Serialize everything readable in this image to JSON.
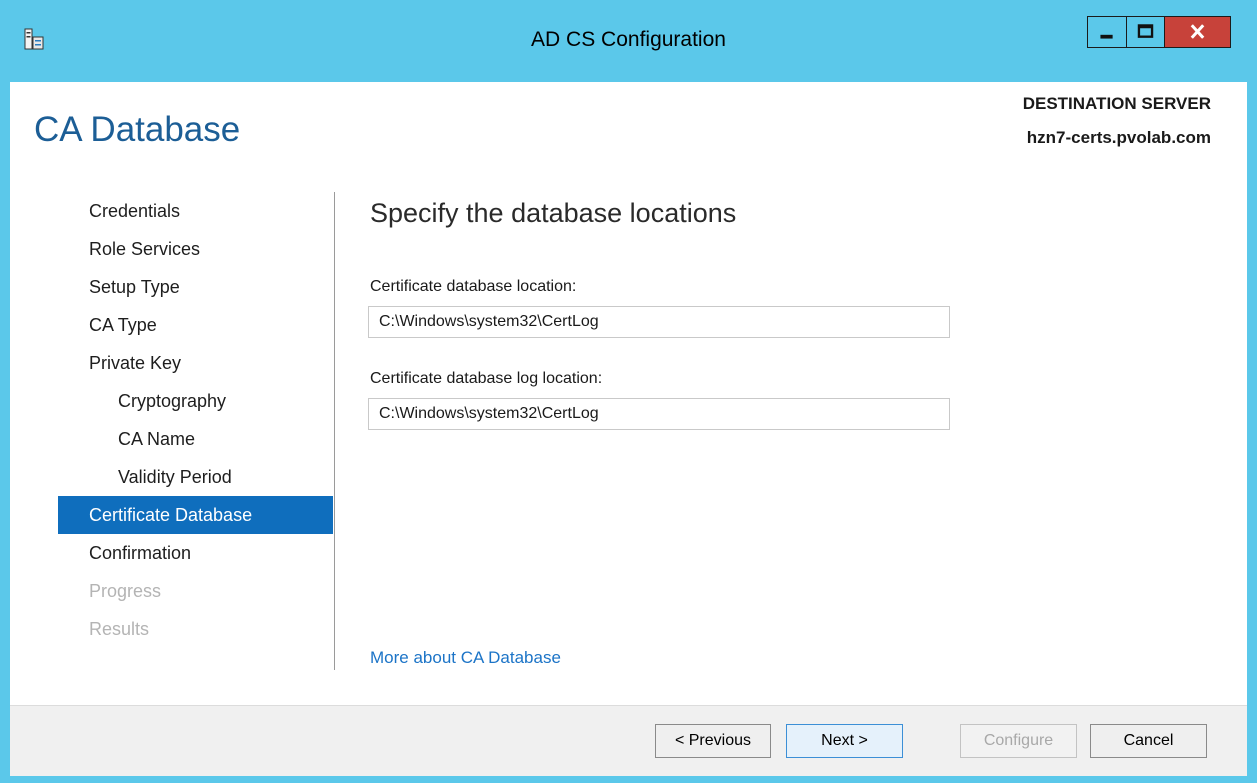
{
  "window": {
    "title": "AD CS Configuration",
    "controls": [
      "minimize-icon",
      "maximize-icon",
      "close-icon"
    ]
  },
  "page": {
    "title": "CA Database",
    "destination_label": "DESTINATION SERVER",
    "destination_server": "hzn7-certs.pvolab.com"
  },
  "nav": {
    "items": [
      {
        "label": "Credentials",
        "state": "normal"
      },
      {
        "label": "Role Services",
        "state": "normal"
      },
      {
        "label": "Setup Type",
        "state": "normal"
      },
      {
        "label": "CA Type",
        "state": "normal"
      },
      {
        "label": "Private Key",
        "state": "normal"
      },
      {
        "label": "Cryptography",
        "state": "sub"
      },
      {
        "label": "CA Name",
        "state": "sub"
      },
      {
        "label": "Validity Period",
        "state": "sub"
      },
      {
        "label": "Certificate Database",
        "state": "active"
      },
      {
        "label": "Confirmation",
        "state": "normal"
      },
      {
        "label": "Progress",
        "state": "disabled"
      },
      {
        "label": "Results",
        "state": "disabled"
      }
    ]
  },
  "main": {
    "heading": "Specify the database locations",
    "db_label": "Certificate database location:",
    "db_value": "C:\\Windows\\system32\\CertLog",
    "log_label": "Certificate database log location:",
    "log_value": "C:\\Windows\\system32\\CertLog",
    "more_link": "More about CA Database"
  },
  "footer": {
    "previous": "< Previous",
    "next": "Next >",
    "configure": "Configure",
    "cancel": "Cancel"
  },
  "colors": {
    "titlebar": "#5bc8ea",
    "accent": "#0f6ebd",
    "heading": "#1c5e96",
    "close_button": "#c7423a",
    "link": "#1c74c7"
  }
}
